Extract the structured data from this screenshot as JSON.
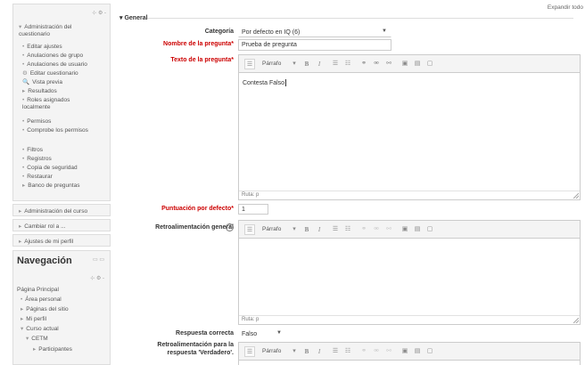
{
  "header": {
    "expand_all": "Expandir todo"
  },
  "sidebar": {
    "admin_block": {
      "controls": "⊹ ⚙ -",
      "items": [
        {
          "label": "Administración del cuestionario",
          "mark": "▾"
        },
        {
          "label": "Editar ajustes",
          "mark": "•"
        },
        {
          "label": "Anulaciones de grupo",
          "mark": "•"
        },
        {
          "label": "Anulaciones de usuario",
          "mark": "•"
        },
        {
          "label": "Editar cuestionario",
          "mark": "⚙"
        },
        {
          "label": "Vista previa",
          "mark": "🔍"
        },
        {
          "label": "Resultados",
          "mark": "▸"
        },
        {
          "label": "Roles asignados localmente",
          "mark": "•"
        },
        {
          "label": "Permisos",
          "mark": "•"
        },
        {
          "label": "Comprobe los permisos",
          "mark": "•"
        },
        {
          "label": "Filtros",
          "mark": "•"
        },
        {
          "label": "Registros",
          "mark": "•"
        },
        {
          "label": "Copia de seguridad",
          "mark": "•"
        },
        {
          "label": "Restaurar",
          "mark": "•"
        },
        {
          "label": "Banco de preguntas",
          "mark": "▸"
        }
      ]
    },
    "rows": [
      {
        "label": "Administración del curso",
        "mark": "▸"
      },
      {
        "label": "Cambiar rol a ...",
        "mark": "▸"
      },
      {
        "label": "Ajustes de mi perfil",
        "mark": "▸"
      }
    ],
    "nav": {
      "title": "Navegación",
      "controls": "▭ ▭",
      "controls2": "⊹ ⚙ -",
      "items": [
        {
          "label": "Página Principal",
          "mark": ""
        },
        {
          "label": "Área personal",
          "mark": "•"
        },
        {
          "label": "Páginas del sitio",
          "mark": "▸"
        },
        {
          "label": "Mi perfil",
          "mark": "▸"
        },
        {
          "label": "Curso actual",
          "mark": "▾"
        },
        {
          "label": "CETM",
          "mark": "▾"
        },
        {
          "label": "Participantes",
          "mark": "▸"
        }
      ]
    }
  },
  "form": {
    "legend": "General",
    "category": {
      "label": "Categoría",
      "value": "Por defecto en IQ (6)"
    },
    "question_name": {
      "label": "Nombre de la pregunta",
      "value": "Prueba de pregunta"
    },
    "question_text": {
      "label": "Texto de la pregunta",
      "content": "Contesta Falso",
      "path": "Ruta: p"
    },
    "default_mark": {
      "label": "Puntuación por defecto",
      "value": "1"
    },
    "general_feedback": {
      "label": "Retroalimentación general",
      "path": "Ruta: p",
      "help": "?"
    },
    "correct_answer": {
      "label": "Respuesta correcta",
      "value": "Falso"
    },
    "true_feedback": {
      "label": "Retroalimentación para la respuesta 'Verdadero'."
    },
    "required_marker": "*",
    "toolbar": {
      "paragraph": "Párrafo",
      "bold": "B",
      "italic": "I"
    }
  }
}
